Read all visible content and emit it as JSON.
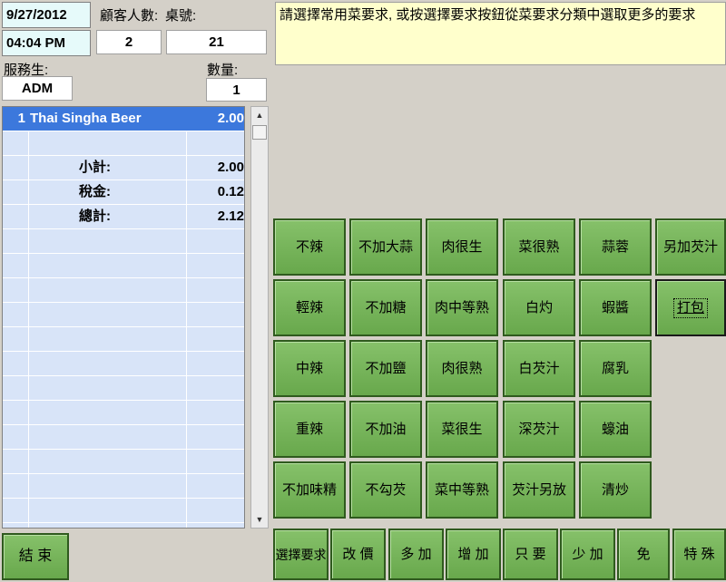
{
  "header": {
    "date": "9/27/2012",
    "time": "04:04 PM",
    "guests_label": "顧客人數:",
    "table_label": "桌號:",
    "guests_value": "2",
    "table_value": "21",
    "server_label": "服務生:",
    "server_value": "ADM",
    "qty_label": "數量:",
    "qty_value": "1"
  },
  "message": "請選擇常用菜要求, 或按選擇要求按鈕從菜要求分類中選取更多的要求",
  "order": {
    "items": [
      {
        "no": "1",
        "name": "Thai Singha Beer",
        "price": "2.00"
      }
    ],
    "subtotal_label": "小計:",
    "subtotal_value": "2.00",
    "tax_label": "稅金:",
    "tax_value": "0.12",
    "total_label": "總計:",
    "total_value": "2.12"
  },
  "scrollbar": {
    "up_glyph": "▲",
    "down_glyph": "▼"
  },
  "requests": [
    [
      "不辣",
      "不加大蒜",
      "肉很生",
      "菜很熟",
      "蒜蓉",
      "另加芡汁"
    ],
    [
      "輕辣",
      "不加糖",
      "肉中等熟",
      "白灼",
      "蝦醬",
      "打包"
    ],
    [
      "中辣",
      "不加鹽",
      "肉很熟",
      "白芡汁",
      "腐乳"
    ],
    [
      "重辣",
      "不加油",
      "菜很生",
      "深芡汁",
      "蠔油"
    ],
    [
      "不加味精",
      "不勾芡",
      "菜中等熟",
      "芡汁另放",
      "清炒"
    ]
  ],
  "bottom": {
    "finish": "結 束",
    "select_request": "選擇要求",
    "change_price": "改 價",
    "more": "多 加",
    "add": "增 加",
    "only": "只 要",
    "less": "少 加",
    "none": "免",
    "special": "特 殊"
  }
}
